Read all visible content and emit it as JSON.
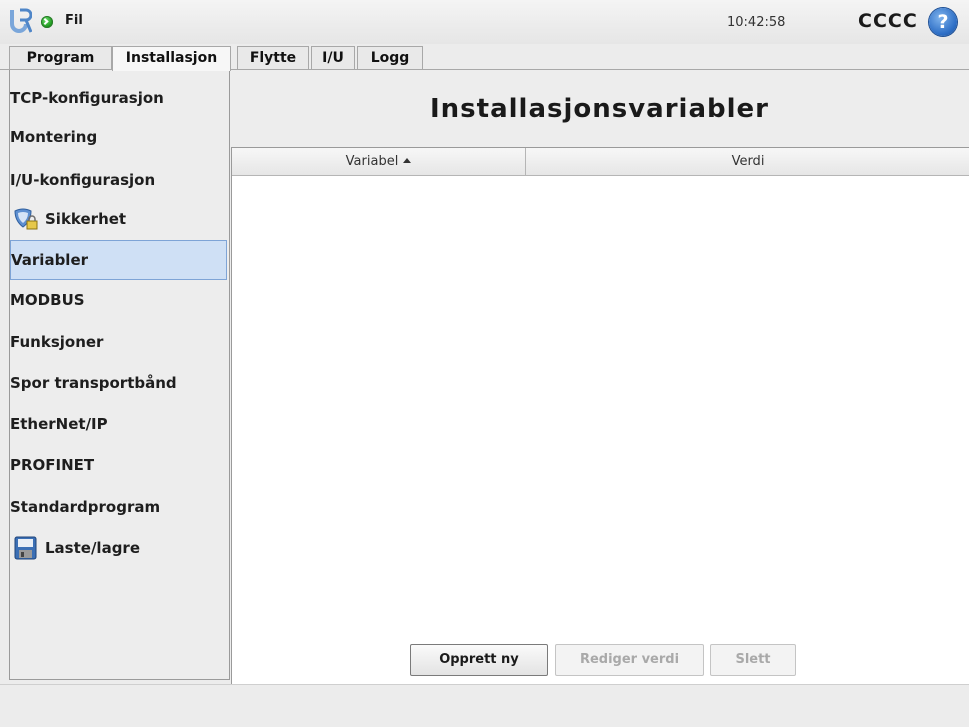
{
  "header": {
    "file_menu": "Fil",
    "clock": "10:42:58",
    "robot_name": "CCCC",
    "help_glyph": "?"
  },
  "tabs": [
    {
      "label": "Program",
      "active": false
    },
    {
      "label": "Installasjon",
      "active": true
    },
    {
      "label": "Flytte",
      "active": false
    },
    {
      "label": "I/U",
      "active": false
    },
    {
      "label": "Logg",
      "active": false
    }
  ],
  "sidebar": {
    "items": [
      {
        "label": "TCP-konfigurasjon"
      },
      {
        "label": "Montering"
      },
      {
        "label": "I/U-konfigurasjon"
      },
      {
        "label": "Sikkerhet",
        "icon": "safety-shield-lock-icon"
      },
      {
        "label": "Variabler",
        "selected": true
      },
      {
        "label": "MODBUS"
      },
      {
        "label": "Funksjoner"
      },
      {
        "label": "Spor transportbånd"
      },
      {
        "label": "EtherNet/IP"
      },
      {
        "label": "PROFINET"
      },
      {
        "label": "Standardprogram"
      },
      {
        "label": "Laste/lagre",
        "icon": "floppy-disk-icon"
      }
    ]
  },
  "main": {
    "title": "Installasjonsvariabler",
    "table": {
      "columns": [
        "Variabel",
        "Verdi"
      ],
      "sort": "ascending",
      "rows": []
    },
    "buttons": {
      "create": "Opprett ny",
      "edit": "Rediger verdi",
      "delete": "Slett"
    }
  },
  "colors": {
    "selection": "#cfe0f5",
    "status_ok": "#1f9a1f",
    "help": "#2e6fc6",
    "logo": "#4f86c8"
  }
}
